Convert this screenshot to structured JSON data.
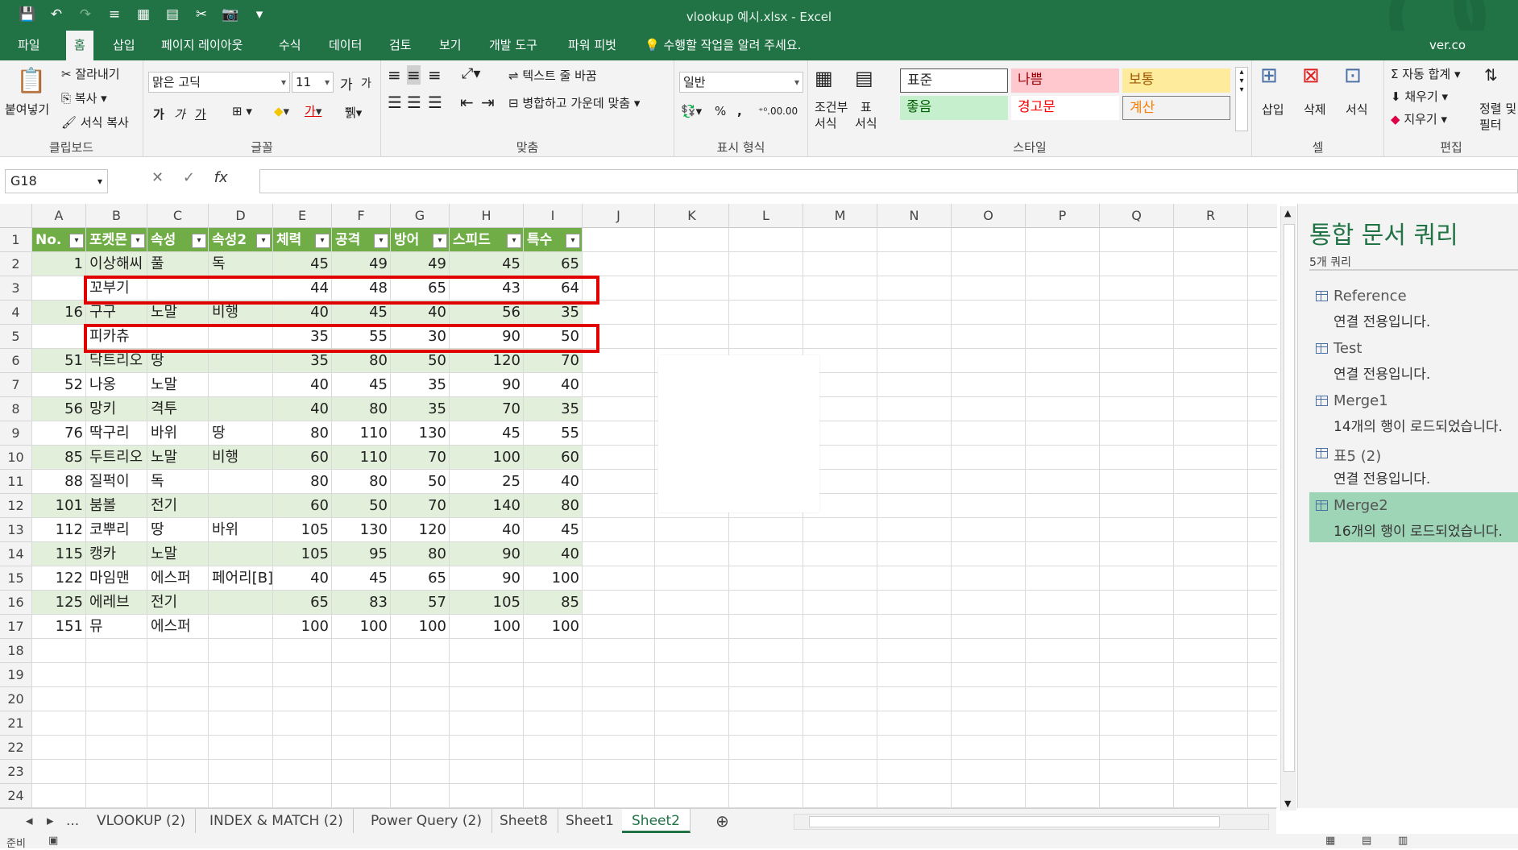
{
  "window": {
    "title": "vlookup 예시.xlsx - Excel",
    "user": "ver.co"
  },
  "menu": {
    "tabs": [
      "파일",
      "홈",
      "삽입",
      "페이지 레이아웃",
      "수식",
      "데이터",
      "검토",
      "보기",
      "개발 도구",
      "파워 피벗"
    ],
    "active": "홈",
    "tell_me": "수행할 작업을 알려 주세요."
  },
  "ribbon": {
    "clipboard": {
      "paste": "붙여넣기",
      "cut": "잘라내기",
      "copy": "복사",
      "format_painter": "서식 복사",
      "label": "클립보드"
    },
    "font": {
      "name": "맑은 고딕",
      "size": "11",
      "label": "글꼴",
      "bold": "가",
      "italic": "가",
      "underline": "가",
      "grow": "가",
      "shrink": "가"
    },
    "alignment": {
      "wrap": "텍스트 줄 바꿈",
      "merge": "병합하고 가운데 맞춤",
      "label": "맞춤"
    },
    "number": {
      "format": "일반",
      "percent": "%",
      "comma": ",",
      "label": "표시 형식"
    },
    "styles": {
      "conditional": "조건부\n서식",
      "table": "표\n서식",
      "boxes": [
        {
          "text": "표준",
          "bg": "#ffffff",
          "color": "#000000"
        },
        {
          "text": "나쁨",
          "bg": "#ffc7ce",
          "color": "#9c0006"
        },
        {
          "text": "보통",
          "bg": "#ffeb9c",
          "color": "#9c5700"
        },
        {
          "text": "좋음",
          "bg": "#c6efce",
          "color": "#006100"
        },
        {
          "text": "경고문",
          "bg": "#ffffff",
          "color": "#ff0000"
        },
        {
          "text": "계산",
          "bg": "#f2f2f2",
          "color": "#fa7d00"
        }
      ],
      "label": "스타일"
    },
    "cells": {
      "insert": "삽입",
      "delete": "삭제",
      "format": "서식",
      "label": "셀"
    },
    "editing": {
      "autosum": "자동 합계",
      "fill": "채우기",
      "clear": "지우기",
      "sort": "정렬 및\n필터",
      "label": "편집"
    }
  },
  "formula_bar": {
    "name_box": "G18",
    "fx": "fx",
    "value": ""
  },
  "columns": [
    "A",
    "B",
    "C",
    "D",
    "E",
    "F",
    "G",
    "H",
    "I",
    "J",
    "K",
    "L",
    "M",
    "N",
    "O",
    "P",
    "Q",
    "R"
  ],
  "rows": [
    "1",
    "2",
    "3",
    "4",
    "5",
    "6",
    "7",
    "8",
    "9",
    "10",
    "11",
    "12",
    "13",
    "14",
    "15",
    "16",
    "17",
    "18",
    "19",
    "20",
    "21",
    "22",
    "23",
    "24"
  ],
  "table": {
    "headers": [
      "No.",
      "포켓몬",
      "속성",
      "속성2",
      "체력",
      "공격",
      "방어",
      "스피드",
      "특수"
    ],
    "rows": [
      [
        "1",
        "이상해씨",
        "풀",
        "독",
        "45",
        "49",
        "49",
        "45",
        "65"
      ],
      [
        "",
        "꼬부기",
        "",
        "",
        "44",
        "48",
        "65",
        "43",
        "64"
      ],
      [
        "16",
        "구구",
        "노말",
        "비행",
        "40",
        "45",
        "40",
        "56",
        "35"
      ],
      [
        "",
        "피카츄",
        "",
        "",
        "35",
        "55",
        "30",
        "90",
        "50"
      ],
      [
        "51",
        "닥트리오",
        "땅",
        "",
        "35",
        "80",
        "50",
        "120",
        "70"
      ],
      [
        "52",
        "나옹",
        "노말",
        "",
        "40",
        "45",
        "35",
        "90",
        "40"
      ],
      [
        "56",
        "망키",
        "격투",
        "",
        "40",
        "80",
        "35",
        "70",
        "35"
      ],
      [
        "76",
        "딱구리",
        "바위",
        "땅",
        "80",
        "110",
        "130",
        "45",
        "55"
      ],
      [
        "85",
        "두트리오",
        "노말",
        "비행",
        "60",
        "110",
        "70",
        "100",
        "60"
      ],
      [
        "88",
        "질퍽이",
        "독",
        "",
        "80",
        "80",
        "50",
        "25",
        "40"
      ],
      [
        "101",
        "붐볼",
        "전기",
        "",
        "60",
        "50",
        "70",
        "140",
        "80"
      ],
      [
        "112",
        "코뿌리",
        "땅",
        "바위",
        "105",
        "130",
        "120",
        "40",
        "45"
      ],
      [
        "115",
        "캥카",
        "노말",
        "",
        "105",
        "95",
        "80",
        "90",
        "40"
      ],
      [
        "122",
        "마임맨",
        "에스퍼",
        "페어리[B]",
        "40",
        "45",
        "65",
        "90",
        "100"
      ],
      [
        "125",
        "에레브",
        "전기",
        "",
        "65",
        "83",
        "57",
        "105",
        "85"
      ],
      [
        "151",
        "뮤",
        "에스퍼",
        "",
        "100",
        "100",
        "100",
        "100",
        "100"
      ]
    ]
  },
  "sheet_tabs": {
    "ellipsis": "...",
    "tabs": [
      "VLOOKUP (2)",
      "INDEX & MATCH (2)",
      "Power Query (2)",
      "Sheet8",
      "Sheet1",
      "Sheet2"
    ],
    "active": "Sheet2"
  },
  "status": {
    "ready": "준비"
  },
  "queries_pane": {
    "title": "통합 문서 쿼리",
    "count": "5개 쿼리",
    "items": [
      {
        "name": "Reference",
        "status": "연결 전용입니다."
      },
      {
        "name": "Test",
        "status": "연결 전용입니다."
      },
      {
        "name": "Merge1",
        "status": "14개의 행이 로드되었습니다."
      },
      {
        "name": "표5 (2)",
        "status": "연결 전용입니다."
      },
      {
        "name": "Merge2",
        "status": "16개의 행이 로드되었습니다.",
        "selected": true
      }
    ]
  },
  "colors": {
    "accent": "#217346",
    "table_header": "#70ad47",
    "band": "#e2efda",
    "highlight": "#e00000"
  }
}
